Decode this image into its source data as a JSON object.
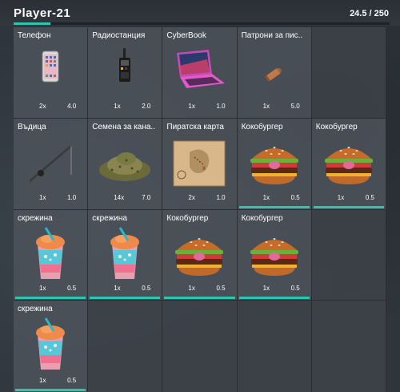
{
  "header": {
    "title": "Player-21",
    "weight": "24.5 / 250",
    "weight_fraction": 0.098
  },
  "accent": "#2cc6b0",
  "slots": [
    {
      "name": "Телефон",
      "icon": "phone-icon",
      "qty": "2x",
      "weight": "4.0",
      "durability": false
    },
    {
      "name": "Радиостанция",
      "icon": "radio-icon",
      "qty": "1x",
      "weight": "2.0",
      "durability": false
    },
    {
      "name": "CyberBook",
      "icon": "laptop-icon",
      "qty": "1x",
      "weight": "1.0",
      "durability": false
    },
    {
      "name": "Патрони за пис..",
      "icon": "bullet-icon",
      "qty": "1x",
      "weight": "5.0",
      "durability": false
    },
    {
      "empty": true
    },
    {
      "name": "Въдица",
      "icon": "fishing-rod-icon",
      "qty": "1x",
      "weight": "1.0",
      "durability": false
    },
    {
      "name": "Семена за кана..",
      "icon": "seeds-icon",
      "qty": "14x",
      "weight": "7.0",
      "durability": false
    },
    {
      "name": "Пиратска карта",
      "icon": "treasure-map-icon",
      "qty": "2x",
      "weight": "1.0",
      "durability": false
    },
    {
      "name": "Кокобургер",
      "icon": "burger-icon",
      "qty": "1x",
      "weight": "0.5",
      "durability": true
    },
    {
      "name": "Кокобургер",
      "icon": "burger-icon",
      "qty": "1x",
      "weight": "0.5",
      "durability": true
    },
    {
      "name": "скрежина",
      "icon": "slushie-icon",
      "qty": "1x",
      "weight": "0.5",
      "durability": true
    },
    {
      "name": "скрежина",
      "icon": "slushie-icon",
      "qty": "1x",
      "weight": "0.5",
      "durability": true
    },
    {
      "name": "Кокобургер",
      "icon": "burger-icon",
      "qty": "1x",
      "weight": "0.5",
      "durability": true
    },
    {
      "name": "Кокобургер",
      "icon": "burger-icon",
      "qty": "1x",
      "weight": "0.5",
      "durability": true
    },
    {
      "empty": true
    },
    {
      "name": "скрежина",
      "icon": "slushie-icon",
      "qty": "1x",
      "weight": "0.5",
      "durability": true
    },
    {
      "empty": true
    },
    {
      "empty": true
    },
    {
      "empty": true
    },
    {
      "empty": true
    }
  ]
}
